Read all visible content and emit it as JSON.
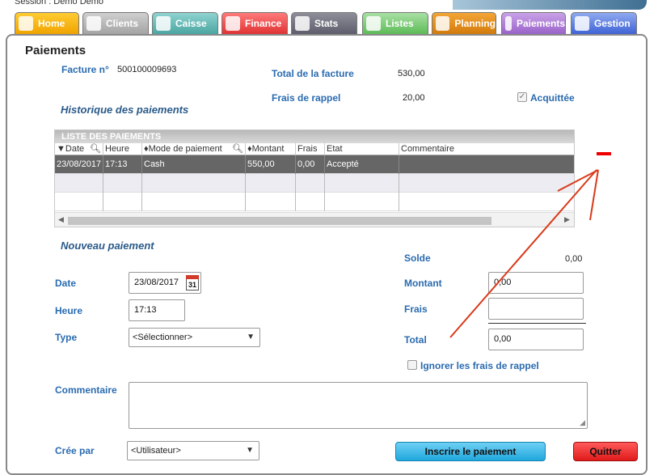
{
  "session": "Session : Demo Demo",
  "tabs": [
    {
      "label": "Home"
    },
    {
      "label": "Clients"
    },
    {
      "label": "Caisse"
    },
    {
      "label": "Finance"
    },
    {
      "label": "Stats"
    },
    {
      "label": "Listes"
    },
    {
      "label": "Planning"
    },
    {
      "label": "Paiements"
    },
    {
      "label": "Gestion"
    }
  ],
  "page": {
    "title": "Paiements",
    "facture_label": "Facture n°",
    "facture_value": "500100009693",
    "total_label": "Total de la facture",
    "total_value": "530,00",
    "frais_rappel_label": "Frais de rappel",
    "frais_rappel_value": "20,00",
    "acquittee_label": "Acquittée",
    "historique_title": "Historique des paiements"
  },
  "grid": {
    "title": "LISTE DES PAIEMENTS",
    "columns": [
      "Date",
      "Heure",
      "Mode de paiement",
      "Montant",
      "Frais",
      "Etat",
      "Commentaire"
    ],
    "rows": [
      {
        "date": "23/08/2017",
        "heure": "17:13",
        "mode": "Cash",
        "montant": "550,00",
        "frais": "0,00",
        "etat": "Accepté",
        "commentaire": ""
      }
    ]
  },
  "nouveau": {
    "title": "Nouveau paiement",
    "date_label": "Date",
    "date_value": "23/08/2017",
    "calendar_day": "31",
    "heure_label": "Heure",
    "heure_value": "17:13",
    "type_label": "Type",
    "type_value": "<Sélectionner>",
    "solde_label": "Solde",
    "solde_value": "0,00",
    "montant_label": "Montant",
    "montant_value": "0,00",
    "frais_label": "Frais",
    "frais_value": "",
    "total_label": "Total",
    "total_value": "0,00",
    "ignorer_label": "Ignorer les frais de rappel",
    "commentaire_label": "Commentaire",
    "cree_par_label": "Crée par",
    "cree_par_value": "<Utilisateur>"
  },
  "buttons": {
    "inscrire": "Inscrire le paiement",
    "quitter": "Quitter"
  }
}
